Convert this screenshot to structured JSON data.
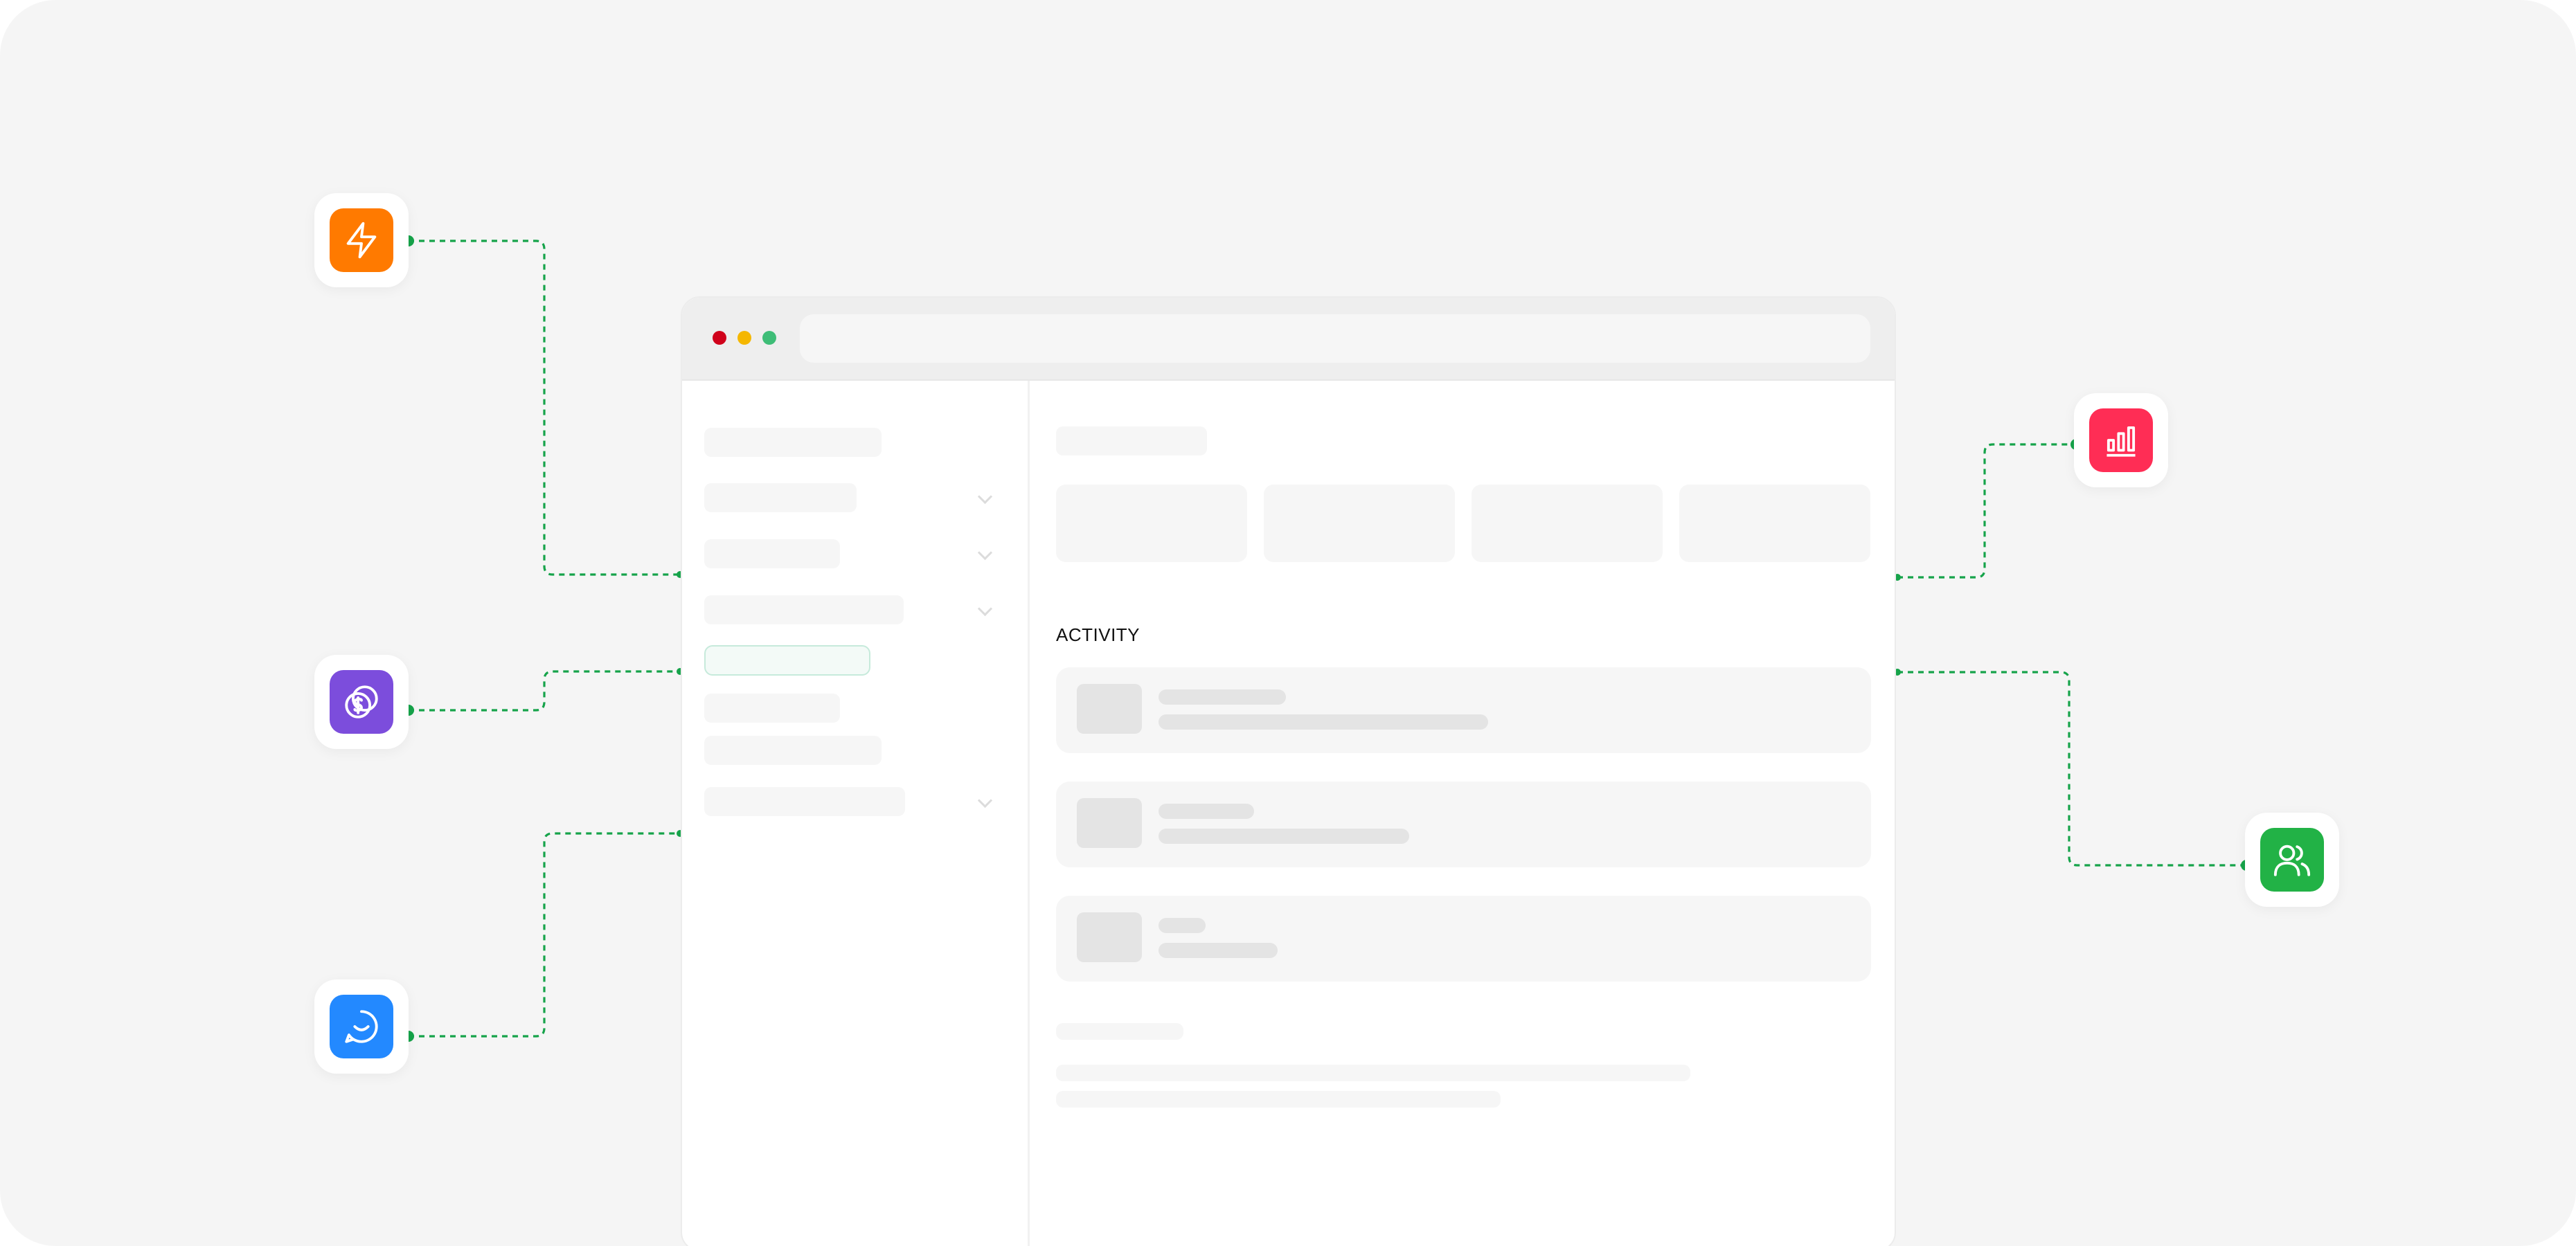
{
  "activity": {
    "title": "ACTIVITY"
  },
  "integrations": [
    {
      "name": "lightning-app",
      "icon": "lightning-icon",
      "color": "#ff7a00"
    },
    {
      "name": "payments-app",
      "icon": "coins-dollar-icon",
      "color": "#7c4ddc"
    },
    {
      "name": "chat-app",
      "icon": "chat-bubble-icon",
      "color": "#2389ff"
    },
    {
      "name": "analytics-app",
      "icon": "bar-chart-icon",
      "color": "#ff2d55"
    },
    {
      "name": "users-app",
      "icon": "users-icon",
      "color": "#22b246"
    }
  ],
  "colors": {
    "connector": "#16a34a",
    "background": "#f5f5f5",
    "active_nav": "#c6eadb"
  }
}
